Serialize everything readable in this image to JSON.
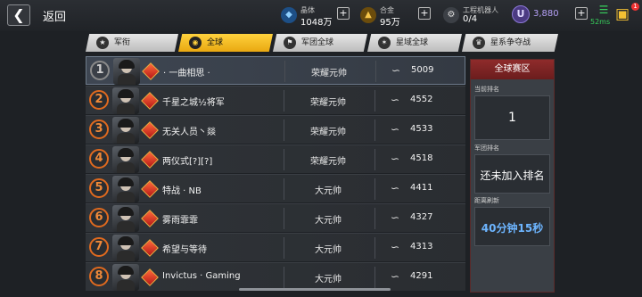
{
  "header": {
    "back_label": "返回",
    "resources": [
      {
        "label": "晶体",
        "value": "1048万",
        "icon": "crystal-icon",
        "color": "#4aa8ff"
      },
      {
        "label": "合金",
        "value": "95万",
        "icon": "alloy-icon",
        "color": "#f0b030"
      },
      {
        "label": "工程机器人",
        "value": "0/4",
        "icon": "robot-icon",
        "color": "#cccccc"
      }
    ],
    "premium_currency": {
      "symbol": "U",
      "value": "3,880"
    },
    "network": {
      "ping": "52ms"
    },
    "cart_badge": "1"
  },
  "tabs": [
    {
      "label": "军衔",
      "icon": "rank-icon",
      "active": false
    },
    {
      "label": "全球",
      "icon": "globe-icon",
      "active": true
    },
    {
      "label": "军团全球",
      "icon": "legion-icon",
      "active": false
    },
    {
      "label": "星域全球",
      "icon": "star-domain-icon",
      "active": false
    },
    {
      "label": "星系争夺战",
      "icon": "trophy-icon",
      "active": false
    }
  ],
  "ranking": [
    {
      "rank": "1",
      "name": "· 一曲相思 ·",
      "title": "荣耀元帅",
      "score": "5009",
      "highlight": true
    },
    {
      "rank": "2",
      "name": "千星之城½将军",
      "title": "荣耀元帅",
      "score": "4552"
    },
    {
      "rank": "3",
      "name": "无关人员丶燚",
      "title": "荣耀元帅",
      "score": "4533"
    },
    {
      "rank": "4",
      "name": "两仪式[?][?]",
      "title": "荣耀元帅",
      "score": "4518"
    },
    {
      "rank": "5",
      "name": "特战 · NB",
      "title": "大元帅",
      "score": "4411"
    },
    {
      "rank": "6",
      "name": "雾雨霏霏",
      "title": "大元帅",
      "score": "4327"
    },
    {
      "rank": "7",
      "name": "希望与等待",
      "title": "大元帅",
      "score": "4313"
    },
    {
      "rank": "8",
      "name": "Invictus · Gaming",
      "title": "大元帅",
      "score": "4291"
    }
  ],
  "panel": {
    "title": "全球赛区",
    "current_rank_label": "当前排名",
    "current_rank": "1",
    "legion_rank_label": "军团排名",
    "legion_rank_status": "还未加入排名",
    "refresh_label": "距离刷新",
    "refresh_timer": "40分钟15秒"
  },
  "colors": {
    "accent_tab": "#f5c023",
    "rank_ring": "#e06a1f",
    "panel_header": "#8f2b2b",
    "timer": "#6db5ff"
  }
}
